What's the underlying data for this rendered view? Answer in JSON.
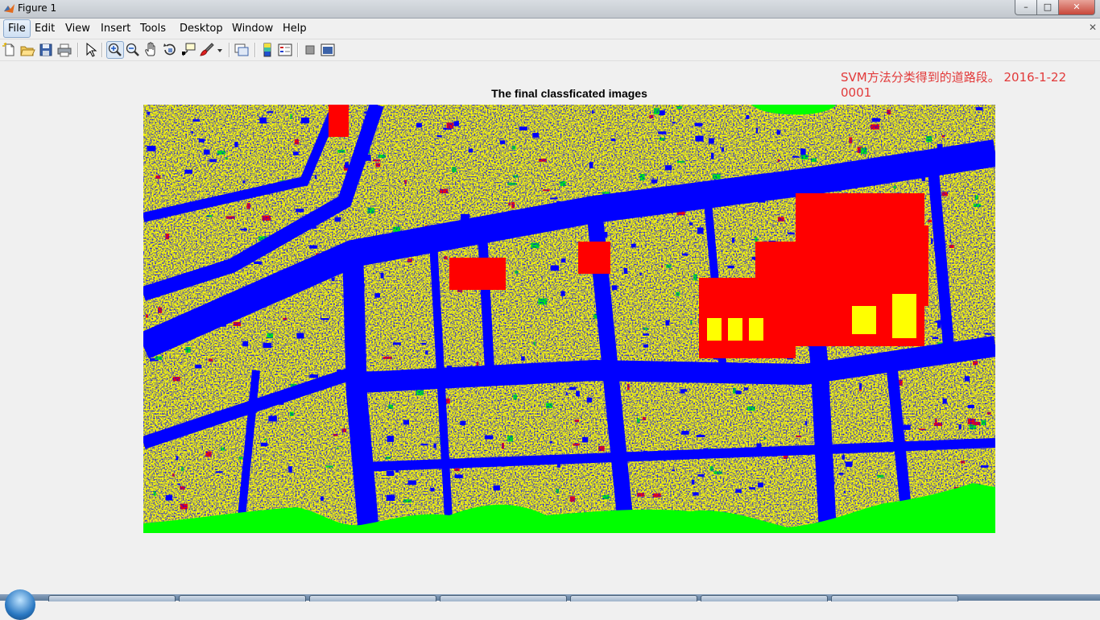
{
  "window": {
    "title": "Figure 1",
    "controls": {
      "minimize": "–",
      "maximize": "□",
      "close": "✕"
    }
  },
  "menu": {
    "items": [
      "File",
      "Edit",
      "View",
      "Insert",
      "Tools",
      "Desktop",
      "Window",
      "Help"
    ],
    "active": "File",
    "close_glyph": "✕"
  },
  "toolbar": {
    "buttons": [
      "new-figure-icon",
      "open-file-icon",
      "save-icon",
      "print-icon",
      "edit-plot-arrow-icon",
      "zoom-in-icon",
      "zoom-out-icon",
      "pan-hand-icon",
      "rotate-3d-icon",
      "data-cursor-icon",
      "brush-icon",
      "brush-dropdown-icon",
      "link-plot-icon",
      "insert-colorbar-icon",
      "insert-legend-icon",
      "hide-plot-tools-icon",
      "show-plot-tools-icon"
    ],
    "pressed": "zoom-in-icon"
  },
  "figure": {
    "title": "The final classficated images",
    "annotation_line1": "SVM方法分类得到的道路段。 2016-1-22",
    "annotation_line2": "0001"
  },
  "colors": {
    "class_blue": "#0000ff",
    "class_yellow": "#ffff00",
    "class_red": "#ff0000",
    "class_green": "#00ff00",
    "annotation_red": "#e23a3a"
  }
}
